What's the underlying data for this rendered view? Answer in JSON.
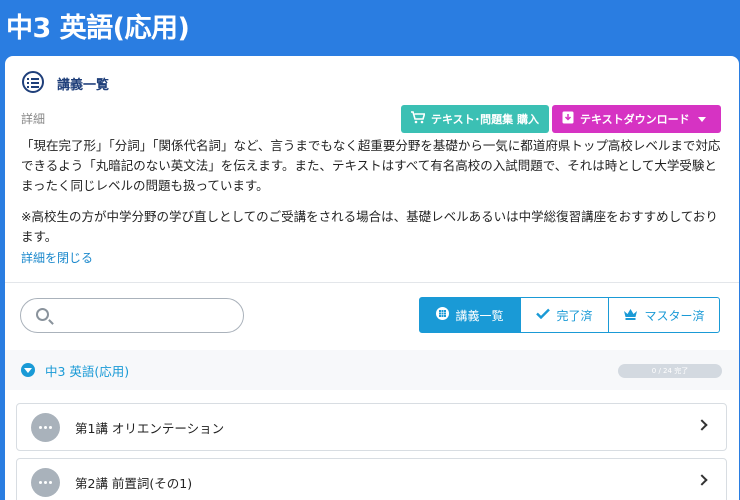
{
  "page": {
    "title": "中3 英語(応用)"
  },
  "card": {
    "title": "講義一覧",
    "detail_label": "詳細",
    "buy_button": "テキスト･問題集 購入",
    "download_button": "テキストダウンロード",
    "description": [
      "「現在完了形」「分詞」「関係代名詞」など、言うまでもなく超重要分野を基礎から一気に都道府県トップ高校レベルまで対応できるよう「丸暗記のない英文法」を伝えます。また、テキストはすべて有名高校の入試問題で、それは時として大学受験とまったく同じレベルの問題も扱っています。",
      "※高校生の方が中学分野の学び直しとしてのご受講をされる場合は、基礎レベルあるいは中学総復習講座をおすすめしております。"
    ],
    "close_link": "詳細を閉じる"
  },
  "search": {
    "placeholder": "",
    "value": ""
  },
  "filters": {
    "all": "講義一覧",
    "done": "完了済",
    "master": "マスター済"
  },
  "section": {
    "title": "中3 英語(応用)",
    "progress_text": "0 / 24 完了",
    "progress_fraction": 0
  },
  "lectures": [
    {
      "title": "第1講 オリエンテーション"
    },
    {
      "title": "第2講 前置詞(その1)"
    }
  ],
  "colors": {
    "header_bg": "#2a7de1",
    "accent": "#1a9ad6",
    "buy": "#3bc0b4",
    "download": "#d633c3"
  }
}
